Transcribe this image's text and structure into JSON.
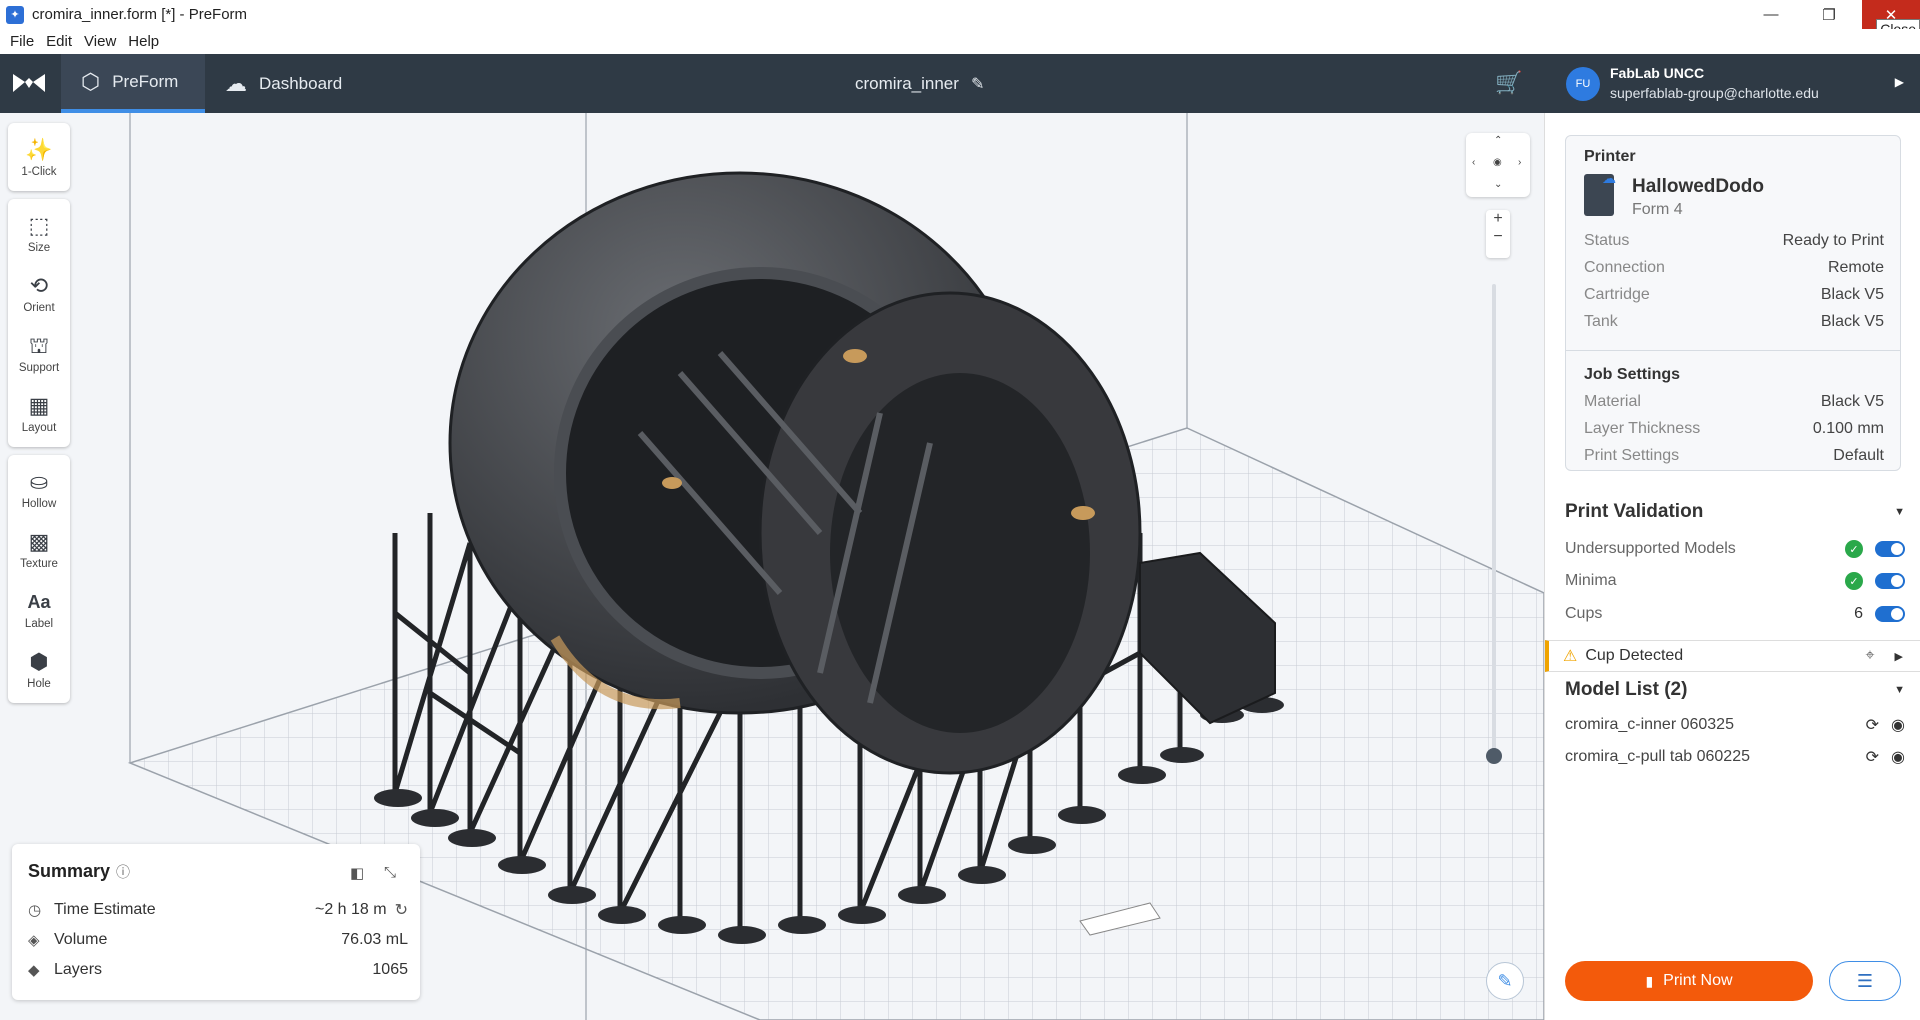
{
  "window": {
    "title": "cromira_inner.form [*] - PreForm",
    "close_tooltip": "Close"
  },
  "menu": [
    "File",
    "Edit",
    "View",
    "Help"
  ],
  "nav": {
    "tab_preform": "PreForm",
    "tab_dashboard": "Dashboard",
    "job_name": "cromira_inner"
  },
  "account": {
    "initials": "FU",
    "org": "FabLab UNCC",
    "email": "superfablab-group@charlotte.edu"
  },
  "tools": [
    "1-Click",
    "Size",
    "Orient",
    "Support",
    "Layout",
    "Hollow",
    "Texture",
    "Label",
    "Hole"
  ],
  "summary": {
    "title": "Summary",
    "time_label": "Time Estimate",
    "time_value": "~2 h 18 m",
    "volume_label": "Volume",
    "volume_value": "76.03 mL",
    "layers_label": "Layers",
    "layers_value": "1065"
  },
  "printer": {
    "section_label": "Printer",
    "name": "HallowedDodo",
    "model": "Form 4",
    "status_label": "Status",
    "status_value": "Ready to Print",
    "connection_label": "Connection",
    "connection_value": "Remote",
    "cartridge_label": "Cartridge",
    "cartridge_value": "Black V5",
    "tank_label": "Tank",
    "tank_value": "Black V5"
  },
  "job_settings": {
    "section_label": "Job Settings",
    "material_label": "Material",
    "material_value": "Black V5",
    "thickness_label": "Layer Thickness",
    "thickness_value": "0.100 mm",
    "settings_label": "Print Settings",
    "settings_value": "Default"
  },
  "validation": {
    "title": "Print Validation",
    "undersupported_label": "Undersupported Models",
    "minima_label": "Minima",
    "cups_label": "Cups",
    "cups_count": "6",
    "cup_detected": "Cup Detected"
  },
  "models": {
    "title": "Model List (2)",
    "items": [
      "cromira_c-inner 060325",
      "cromira_c-pull tab 060225"
    ]
  },
  "actions": {
    "print_now": "Print Now"
  },
  "colors": {
    "accent": "#3f8ee6",
    "print_button": "#f35a0b",
    "nav_bg": "#2f3a45",
    "warning": "#f0a400",
    "ok": "#2aa84a"
  }
}
